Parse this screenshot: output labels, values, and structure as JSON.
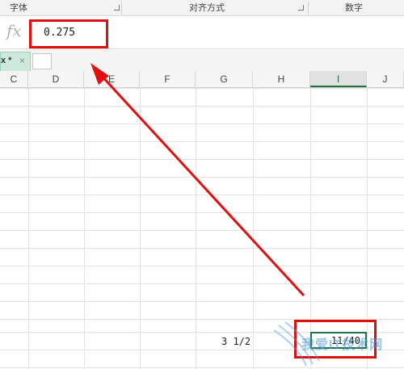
{
  "ribbon": {
    "groups": [
      {
        "label": "字体"
      },
      {
        "label": "对齐方式"
      },
      {
        "label": "数字"
      }
    ]
  },
  "formula_bar": {
    "fx_symbol": "fx",
    "value": "0.275"
  },
  "tabs": {
    "active_label": "x *",
    "close_symbol": "×"
  },
  "columns": [
    "C",
    "D",
    "E",
    "F",
    "G",
    "H",
    "I",
    "J"
  ],
  "active_column": "I",
  "cells": {
    "h_row_value": "3 1/2",
    "active_value": "11/40"
  },
  "watermark": {
    "text": "我爱IT技术网"
  },
  "colors": {
    "annotation": "#e01010",
    "selection": "#217346"
  }
}
